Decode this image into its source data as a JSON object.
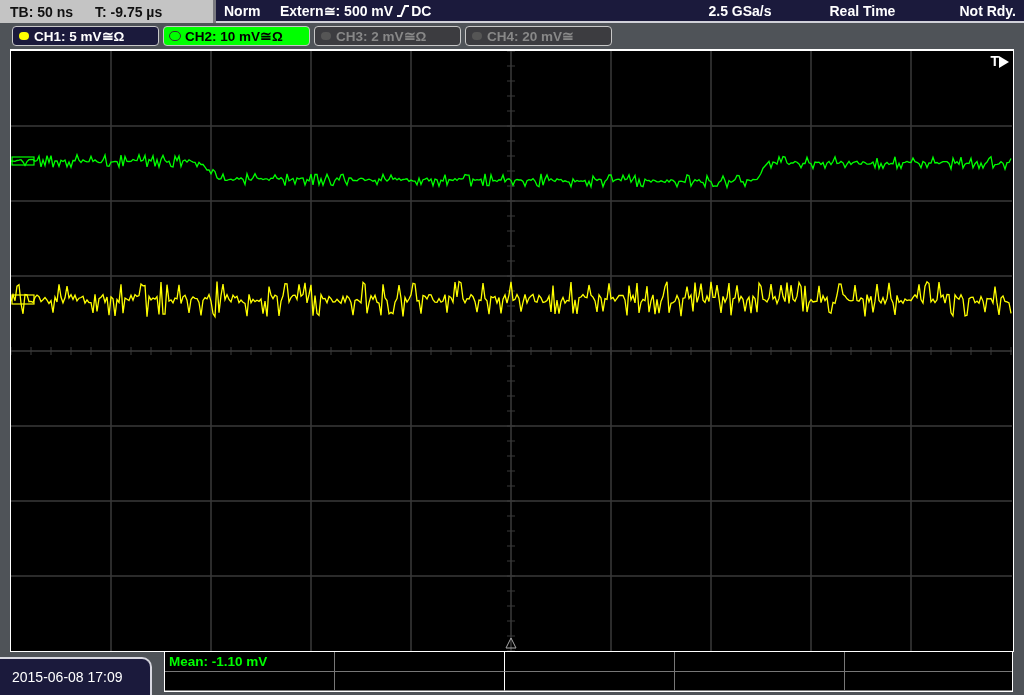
{
  "header": {
    "timebase": "TB: 50 ns",
    "trigger_time": "T: -9.75 µs",
    "mode": "Norm",
    "trigger_source": "Extern≅: 500 mV",
    "coupling": "DC",
    "sample_rate": "2.5 GSa/s",
    "acquisition": "Real Time",
    "status": "Not Rdy."
  },
  "channels": [
    {
      "label": "CH1: 5 mV≅Ω",
      "on": true,
      "selected": false,
      "color": "#ffff00"
    },
    {
      "label": "CH2: 10 mV≅Ω",
      "on": true,
      "selected": true,
      "color": "#00ff00"
    },
    {
      "label": "CH3: 2 mV≅Ω",
      "on": false,
      "selected": false,
      "color": "#555555"
    },
    {
      "label": "CH4: 20 mV≅",
      "on": false,
      "selected": false,
      "color": "#555555"
    }
  ],
  "plot": {
    "trigger_label": "T"
  },
  "measurements": {
    "rows": [
      [
        "Mean: -1.10 mV"
      ]
    ]
  },
  "footer": {
    "datetime": "2015-06-08 17:09"
  }
}
